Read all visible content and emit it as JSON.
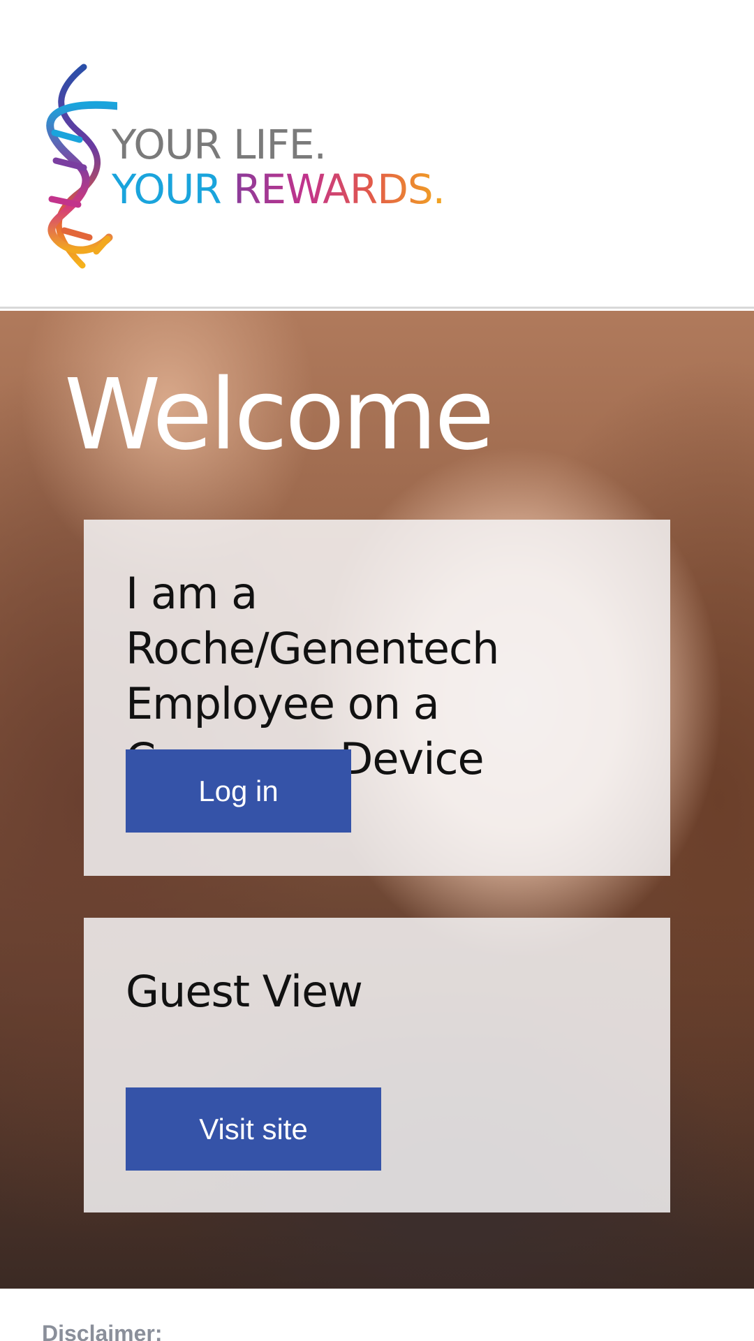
{
  "header": {
    "logo_line1": "YOUR LIFE.",
    "logo_line2_part1": "YOUR ",
    "logo_line2_part2": "REWARDS."
  },
  "hero": {
    "title": "Welcome"
  },
  "cards": {
    "employee": {
      "heading": "I am a Roche/Genentech Employee on a Company Device",
      "button": "Log in"
    },
    "guest": {
      "heading": "Guest View",
      "button": "Visit site"
    }
  },
  "footer": {
    "disclaimer": "Disclaimer:"
  },
  "colors": {
    "button_bg": "#3553a8",
    "logo_gray": "#7a7a7a",
    "logo_blue": "#1aa4dc",
    "disclaimer": "#8a8f9a"
  }
}
